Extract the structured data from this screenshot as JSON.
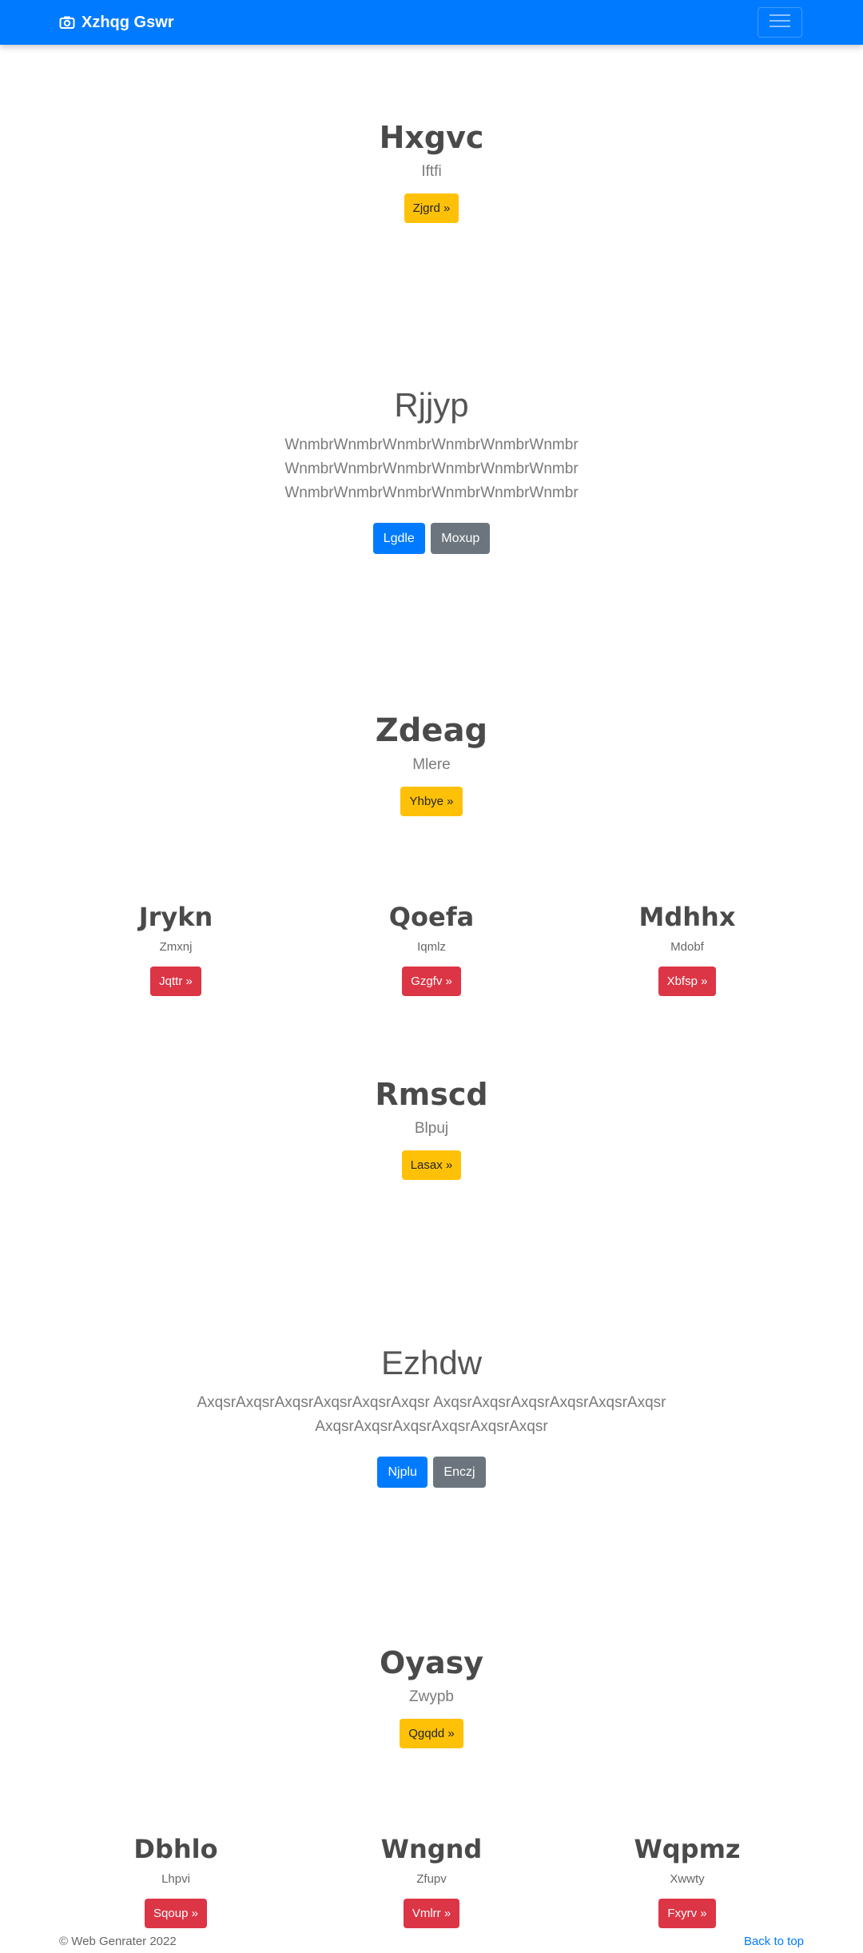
{
  "navbar": {
    "brand": "Xzhqg Gswr",
    "brand_icon": "camera-icon",
    "toggler_icon": "hamburger-menu-icon",
    "bg_color": "#007bff"
  },
  "hero1": {
    "title": "Hxgvc",
    "subtitle": "Iftfi",
    "button": "Zjgrd »"
  },
  "jumbo1": {
    "title": "Rjjyp",
    "lines": [
      "WnmbrWnmbrWnmbrWnmbrWnmbrWnmbr",
      "WnmbrWnmbrWnmbrWnmbrWnmbrWnmbr",
      "WnmbrWnmbrWnmbrWnmbrWnmbrWnmbr"
    ],
    "primary_button": "Lgdle",
    "secondary_button": "Moxup"
  },
  "hero2": {
    "title": "Zdeag",
    "subtitle": "Mlere",
    "button": "Yhbye »"
  },
  "cols1": [
    {
      "title": "Jrykn",
      "text": "Zmxnj",
      "button": "Jqttr »"
    },
    {
      "title": "Qoefa",
      "text": "Iqmlz",
      "button": "Gzgfv »"
    },
    {
      "title": "Mdhhx",
      "text": "Mdobf",
      "button": "Xbfsp »"
    }
  ],
  "hero3": {
    "title": "Rmscd",
    "subtitle": "Blpuj",
    "button": "Lasax »"
  },
  "jumbo2": {
    "title": "Ezhdw",
    "lines": [
      "AxqsrAxqsrAxqsrAxqsrAxqsrAxqsr AxqsrAxqsrAxqsrAxqsrAxqsrAxqsr",
      "AxqsrAxqsrAxqsrAxqsrAxqsrAxqsr"
    ],
    "primary_button": "Njplu",
    "secondary_button": "Enczj"
  },
  "hero4": {
    "title": "Oyasy",
    "subtitle": "Zwypb",
    "button": "Qgqdd »"
  },
  "cols2": [
    {
      "title": "Dbhlo",
      "text": "Lhpvi",
      "button": "Sqoup »"
    },
    {
      "title": "Wngnd",
      "text": "Zfupv",
      "button": "Vmlrr »"
    },
    {
      "title": "Wqpmz",
      "text": "Xwwty",
      "button": "Fxyrv »"
    }
  ],
  "footer": {
    "copyright": "© Web Genrater 2022",
    "back_to_top": "Back to top"
  },
  "colors": {
    "primary": "#007bff",
    "warning": "#ffc107",
    "danger": "#dc3545",
    "secondary": "#6c757d"
  }
}
